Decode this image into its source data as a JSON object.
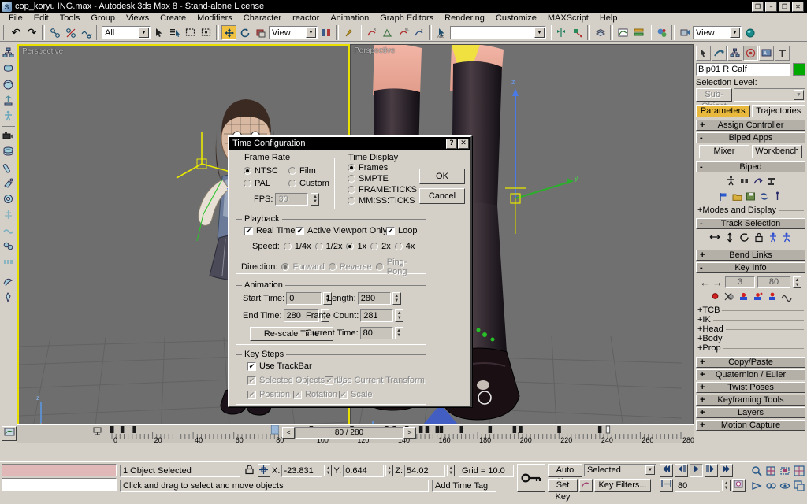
{
  "window": {
    "title": "cop_koryu ING.max - Autodesk 3ds Max 8  - Stand-alone License",
    "app_icon": "max-logo-icon",
    "controls": {
      "restore_sub": "❐",
      "minimize": "–",
      "restore": "❐",
      "close": "✕"
    }
  },
  "menu": {
    "items": [
      "File",
      "Edit",
      "Tools",
      "Group",
      "Views",
      "Create",
      "Modifiers",
      "Character",
      "reactor",
      "Animation",
      "Graph Editors",
      "Rendering",
      "Customize",
      "MAXScript",
      "Help"
    ]
  },
  "toolbar": {
    "undo": "↶",
    "redo": "↷",
    "select_link": "select-and-link-icon",
    "unlink": "unlink-selection-icon",
    "bind_space_warp": "bind-to-space-warp-icon",
    "selection_filter_value": "All",
    "select_object": "▶",
    "select_by_name": "select-by-name-icon",
    "rect_select": "rectangular-selection-region-icon",
    "window_crossing": "window-crossing-icon",
    "select_move": "select-and-move-icon",
    "select_rotate": "select-and-rotate-icon",
    "select_scale": "select-and-uniform-scale-icon",
    "ref_coord_value": "View",
    "use_center": "use-pivot-point-center-icon",
    "select_manipulate": "select-and-manipulate-icon",
    "snap3d": "snaps-toggle-icon",
    "angle_snap": "angle-snap-toggle-icon",
    "percent_snap": "percent-snap-toggle-icon",
    "spinner_snap": "spinner-snap-toggle-icon",
    "named_sel_sets": "named-selection-sets-icon",
    "named_sel_value": "",
    "mirror": "mirror-icon",
    "align": "align-icon",
    "layer_manager": "layer-manager-icon",
    "curve_editor": "curve-editor-icon",
    "schematic_view": "schematic-view-icon",
    "material_editor": "material-editor-icon",
    "render_scene": "render-scene-dialog-icon",
    "render_view_value": "View",
    "quick_render": "quick-render-icon"
  },
  "left_tools": [
    {
      "name": "hierarchy-icon"
    },
    {
      "name": "helpers-icon"
    },
    {
      "name": "space-warps-icon"
    },
    {
      "name": "systems-icon"
    },
    {
      "name": "biped-icon"
    },
    {
      "name": "camera-icon"
    },
    {
      "name": "disc-icon"
    },
    {
      "name": "eraser-icon"
    },
    {
      "name": "spray-icon"
    },
    {
      "name": "gear-icon"
    },
    {
      "name": "particle-icon"
    },
    {
      "name": "cloth-icon"
    },
    {
      "name": "dynamics-icon"
    },
    {
      "name": "grid-icon"
    },
    {
      "name": "ribbon-icon"
    },
    {
      "name": "bone-icon"
    }
  ],
  "viewports": [
    {
      "label": "Perspective",
      "active": true
    },
    {
      "label": "Perspective",
      "active": false
    }
  ],
  "axis_gizmo": {
    "x": "x",
    "y": "y",
    "z": "z"
  },
  "command_panel": {
    "tabs": [
      {
        "icon": "create-tab-icon",
        "selected": false
      },
      {
        "icon": "modify-tab-icon",
        "selected": false
      },
      {
        "icon": "hierarchy-tab-icon",
        "selected": false
      },
      {
        "icon": "motion-tab-icon",
        "selected": true
      },
      {
        "icon": "display-tab-icon",
        "selected": false
      },
      {
        "icon": "utilities-tab-icon",
        "selected": false
      }
    ],
    "object_name": "Bip01 R Calf",
    "object_color": "#00a800",
    "selection_level_label": "Selection Level:",
    "sub_object_btn": "Sub-Object",
    "sub_object_value": "",
    "param_tab": "Parameters",
    "traj_tab": "Trajectories",
    "rollouts": {
      "assign_controller": {
        "sign": "+",
        "title": "Assign Controller"
      },
      "biped_apps": {
        "sign": "-",
        "title": "Biped Apps",
        "mixer": "Mixer",
        "workbench": "Workbench"
      },
      "biped": {
        "sign": "-",
        "title": "Biped",
        "modes_and_display": "+Modes and Display"
      },
      "track_selection": {
        "sign": "-",
        "title": "Track Selection"
      },
      "bend_links": {
        "sign": "+",
        "title": "Bend Links"
      },
      "key_info": {
        "sign": "-",
        "title": "Key Info",
        "key_number": "3",
        "key_time": "80",
        "sub": [
          "+TCB",
          "+IK",
          "+Head",
          "+Body",
          "+Prop"
        ]
      },
      "copy_paste": {
        "sign": "+",
        "title": "Copy/Paste"
      },
      "quaternion_euler": {
        "sign": "+",
        "title": "Quaternion / Euler"
      },
      "twist_poses": {
        "sign": "+",
        "title": "Twist Poses"
      },
      "keyframing_tools": {
        "sign": "+",
        "title": "Keyframing Tools"
      },
      "layers": {
        "sign": "+",
        "title": "Layers"
      },
      "motion_capture": {
        "sign": "+",
        "title": "Motion Capture"
      }
    }
  },
  "time_slider": {
    "prev": "<",
    "next": ">",
    "value": "80 / 280"
  },
  "track_bar": {
    "icon": "open-mini-curve-editor-icon",
    "tick_labels": [
      "0",
      "20",
      "40",
      "60",
      "80",
      "100",
      "120",
      "140",
      "160",
      "180",
      "200",
      "220",
      "240",
      "260",
      "280"
    ],
    "current_frame": 80,
    "range_start": 0,
    "range_end": 280,
    "keys": [
      0,
      5,
      11,
      80,
      98,
      118,
      135,
      139,
      145,
      152,
      155,
      160,
      162,
      172,
      186,
      198,
      201,
      220,
      240,
      244
    ]
  },
  "status_bar": {
    "maxscript_prompt": "",
    "maxscript_input": "",
    "selection_text": "1 Object Selected",
    "lock_icon": "selection-lock-toggle-icon",
    "abs_rel_icon": "absolute-relative-transform-toggle-icon",
    "x_label": "X:",
    "x_value": "-23.831",
    "y_label": "Y:",
    "y_value": "0.644",
    "z_label": "Z:",
    "z_value": "54.02",
    "grid_text": "Grid = 10.0",
    "hint_text": "Click and drag to select and move objects",
    "add_time_tag": "Add Time Tag",
    "key_mode_icon": "key-mode-toggle-icon",
    "auto_key": "Auto Key",
    "set_key": "Set Key",
    "key_filter_set": "Selected",
    "set_key_curve_icon": "set-key-filters-icon",
    "key_filters": "Key Filters...",
    "playback": {
      "goto_start": "⏮",
      "prev_frame": "⏴",
      "play": "▶",
      "next_frame": "⏵",
      "goto_end": "⏭",
      "key_mode": "⏭",
      "current_frame": "80",
      "time_config_icon": "time-configuration-icon"
    },
    "view_tools": [
      "zoom-icon",
      "zoom-all-icon",
      "zoom-extents-icon",
      "zoom-extents-all-icon",
      "field-of-view-icon",
      "pan-icon",
      "arc-rotate-icon",
      "min-max-toggle-icon"
    ]
  },
  "dialog": {
    "title": "Time Configuration",
    "help_btn": "?",
    "close_btn": "✕",
    "frame_rate": {
      "title": "Frame Rate",
      "options": [
        {
          "label": "NTSC",
          "selected": true
        },
        {
          "label": "Film",
          "selected": false
        },
        {
          "label": "PAL",
          "selected": false
        },
        {
          "label": "Custom",
          "selected": false
        }
      ],
      "fps_label": "FPS:",
      "fps_value": "30",
      "fps_disabled": true
    },
    "time_display": {
      "title": "Time Display",
      "options": [
        {
          "label": "Frames",
          "selected": true
        },
        {
          "label": "SMPTE",
          "selected": false
        },
        {
          "label": "FRAME:TICKS",
          "selected": false
        },
        {
          "label": "MM:SS:TICKS",
          "selected": false
        }
      ]
    },
    "playback": {
      "title": "Playback",
      "real_time": {
        "label": "Real Time",
        "checked": true
      },
      "active_viewport_only": {
        "label": "Active Viewport Only",
        "checked": true
      },
      "loop": {
        "label": "Loop",
        "checked": true
      },
      "speed_label": "Speed:",
      "speeds": [
        {
          "label": "1/4x",
          "selected": false
        },
        {
          "label": "1/2x",
          "selected": false
        },
        {
          "label": "1x",
          "selected": true
        },
        {
          "label": "2x",
          "selected": false
        },
        {
          "label": "4x",
          "selected": false
        }
      ],
      "direction_label": "Direction:",
      "directions": [
        {
          "label": "Forward",
          "selected": true,
          "disabled": true
        },
        {
          "label": "Reverse",
          "selected": false,
          "disabled": true
        },
        {
          "label": "Ping-Pong",
          "selected": false,
          "disabled": true
        }
      ]
    },
    "animation": {
      "title": "Animation",
      "start_time_label": "Start Time:",
      "start_time_value": "0",
      "end_time_label": "End Time:",
      "end_time_value": "280",
      "length_label": "Length:",
      "length_value": "280",
      "frame_count_label": "Frame Count:",
      "frame_count_value": "281",
      "current_time_label": "Current Time:",
      "current_time_value": "80",
      "rescale_btn": "Re-scale Time"
    },
    "key_steps": {
      "title": "Key Steps",
      "use_trackbar": {
        "label": "Use TrackBar",
        "checked": true,
        "disabled": false
      },
      "selected_objects_only": {
        "label": "Selected Objects Only",
        "checked": true,
        "disabled": true
      },
      "use_current_transform": {
        "label": "Use Current Transform",
        "checked": true,
        "disabled": true
      },
      "position": {
        "label": "Position",
        "checked": true,
        "disabled": true
      },
      "rotation": {
        "label": "Rotation",
        "checked": true,
        "disabled": true
      },
      "scale": {
        "label": "Scale",
        "checked": true,
        "disabled": true
      }
    },
    "ok_btn": "OK",
    "cancel_btn": "Cancel"
  }
}
